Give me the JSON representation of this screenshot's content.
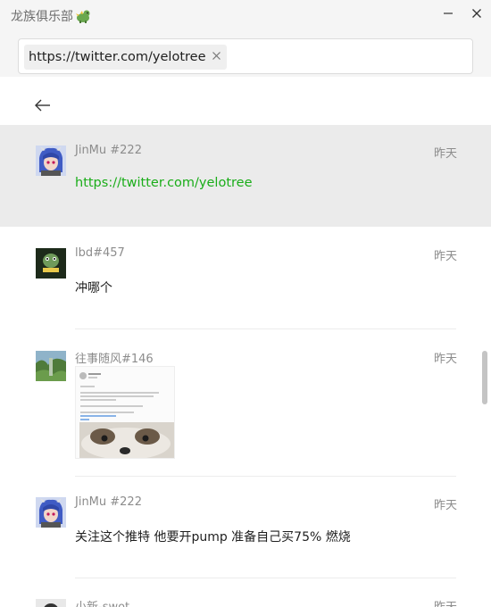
{
  "app": {
    "title": "龙族俱乐部",
    "title_emoji_icon": "dragon-icon"
  },
  "window": {
    "minimize_glyph": "—",
    "close_glyph": "✕"
  },
  "search": {
    "tag_text": "https://twitter.com/yelotree",
    "tag_close": "✕"
  },
  "colors": {
    "link": "#1aad19",
    "highlight": "#ebebeb",
    "meta": "#8c8c8c"
  },
  "messages": [
    {
      "author": "JinMu #222",
      "time": "昨天",
      "text": "https://twitter.com/yelotree",
      "highlighted": true
    },
    {
      "author": "lbd#457",
      "time": "昨天",
      "text": "冲哪个"
    },
    {
      "author": "往事随风#146",
      "time": "昨天",
      "text": ""
    },
    {
      "author": "JinMu #222",
      "time": "昨天",
      "text": "关注这个推特 他要开pump 准备自己买75% 燃烧"
    },
    {
      "author": "小新-swot",
      "time": "昨天",
      "text": ""
    }
  ]
}
